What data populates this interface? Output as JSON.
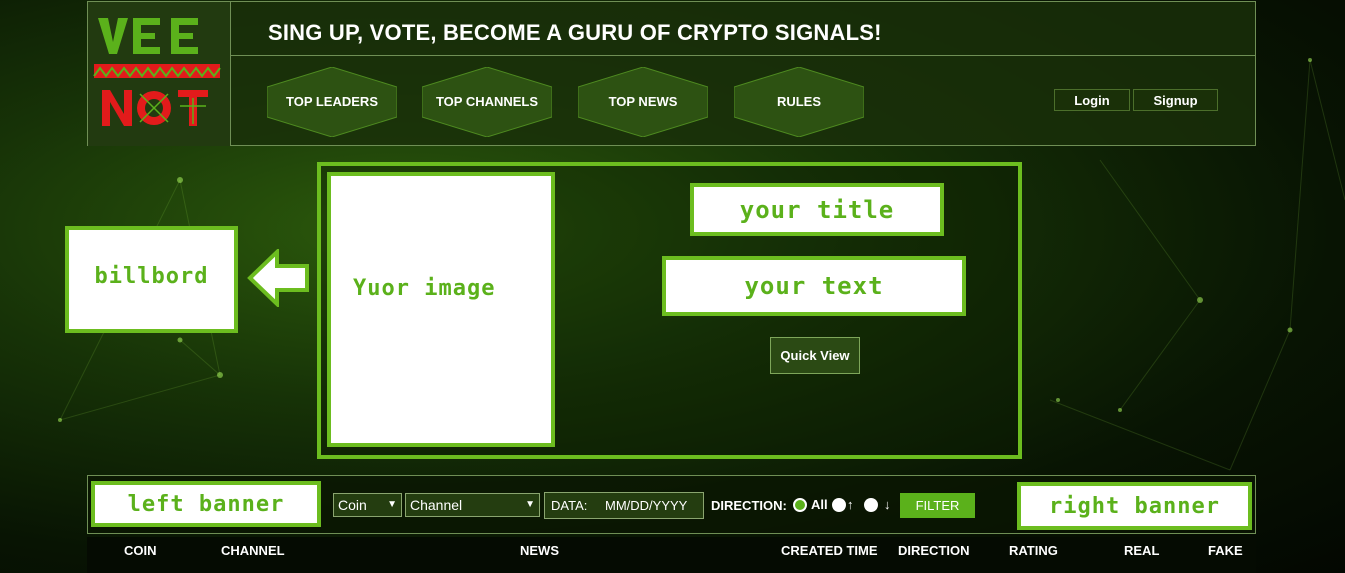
{
  "header": {
    "logo_text": "VEE NOT",
    "tagline": "SING UP, VOTE, BECOME A GURU OF CRYPTO SIGNALS!",
    "nav": [
      {
        "label": "TOP LEADERS"
      },
      {
        "label": "TOP CHANNELS"
      },
      {
        "label": "TOP NEWS"
      },
      {
        "label": "RULES"
      }
    ],
    "login_label": "Login",
    "signup_label": "Signup"
  },
  "billboard": {
    "label": "billbord"
  },
  "feature": {
    "image_label": "Yuor image",
    "title_label": "your title",
    "text_label": "your text",
    "quick_view_label": "Quick View"
  },
  "filter": {
    "left_banner": "left banner",
    "right_banner": "right banner",
    "coin_value": "Coin",
    "channel_value": "Channel",
    "data_label": "DATA:",
    "date_placeholder": "MM/DD/YYYY",
    "direction_label": "DIRECTION:",
    "all_label": "All",
    "up_glyph": "↑",
    "down_glyph": "↓",
    "filter_label": "FILTER"
  },
  "table": {
    "columns": [
      "COIN",
      "CHANNEL",
      "NEWS",
      "CREATED TIME",
      "DIRECTION",
      "RATING",
      "REAL",
      "FAKE"
    ]
  },
  "colors": {
    "accent": "#6cbd1f",
    "logo_green": "#5bb11b",
    "logo_red": "#e21b1b"
  }
}
